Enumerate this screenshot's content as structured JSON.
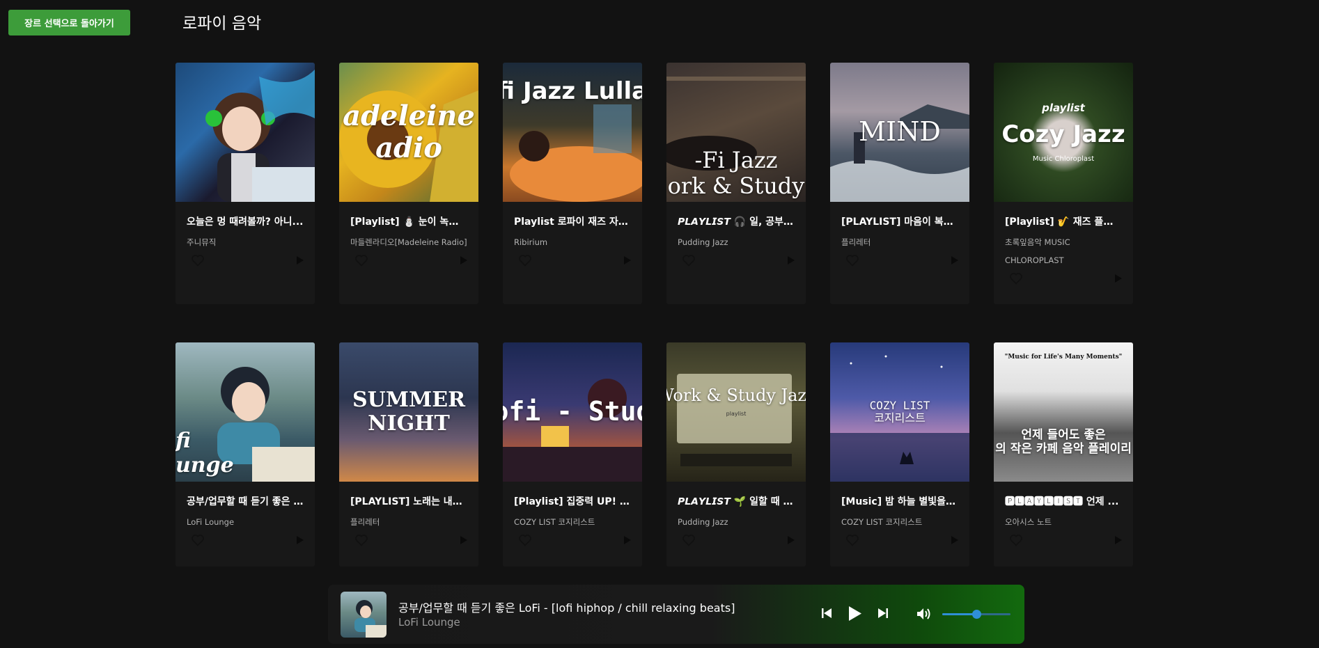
{
  "header": {
    "back_label": "장르 선택으로 돌아가기",
    "page_title": "로파이 음악"
  },
  "row1": [
    {
      "title": "오늘은 멍 때려볼까? 아니...",
      "artist": "주니뮤직",
      "cover_text": ""
    },
    {
      "title": "[Playlist] ⛄ 눈이 녹고 봄...",
      "artist": "마들렌라디오[Madeleine Radio]",
      "cover_text": "adeleine adio"
    },
    {
      "title": "Playlist 로파이 재즈 자장...",
      "artist": "Ribirium",
      "cover_text": "fi Jazz Lulla"
    },
    {
      "title": "𝙋𝙇𝘼𝙔𝙇𝙄𝙎𝙏 🎧 일, 공부할 ...",
      "artist": "Pudding Jazz",
      "cover_text": "-Fi Jazz\nork & Study"
    },
    {
      "title": "[PLAYLIST] 마음이 복잡...",
      "artist": "플리레터",
      "cover_text": "MIND"
    },
    {
      "title": "[Playlist] 🎷 재즈 플레이...",
      "artist": "초록잎음악 MUSIC CHLOROPLAST",
      "cover_text": "Cozy Jazz"
    }
  ],
  "row2": [
    {
      "title": "공부/업무할 때 듣기 좋은 ...",
      "artist": "LoFi Lounge",
      "cover_text": "fi\nunge"
    },
    {
      "title": "[PLAYLIST] 노래는 내가 ...",
      "artist": "플리레터",
      "cover_text": "SUMMER\nNIGHT"
    },
    {
      "title": "[Playlist] 집중력 UP! 공부...",
      "artist": "COZY LIST 코지리스트",
      "cover_text": "ofi - Stud"
    },
    {
      "title": "𝙋𝙇𝘼𝙔𝙇𝙄𝙎𝙏 🌱 일할 때 틀...",
      "artist": "Pudding Jazz",
      "cover_text": "Work & Study Jazz"
    },
    {
      "title": "[Music] 밤 하늘 별빛을 보...",
      "artist": "COZY LIST 코지리스트",
      "cover_text": "COZY LIST\n코지리스트"
    },
    {
      "title": "🅿🅻🅰🆈🅻🅸🆂🆃 언제 ...",
      "artist": "오아시스 노트",
      "cover_text": "언제 들어도 좋은\n의 작은 카페 음악 플레이리"
    }
  ],
  "cover_extras": {
    "c6_top": "playlist",
    "c6_sub": "Music Chloroplast",
    "c10_sub": "playlist",
    "c12_top": "\"Music for Life's Many Moments\""
  },
  "player": {
    "title": "공부/업무할 때 듣기 좋은 LoFi - [lofi hiphop / chill relaxing beats]",
    "artist": "LoFi Lounge",
    "volume": 0.5
  },
  "icons": {
    "heart": "heart-outline-icon",
    "play": "play-icon",
    "prev": "skip-previous-icon",
    "next": "skip-next-icon",
    "volume": "volume-icon"
  },
  "colors": {
    "accent_green": "#3d9c3a",
    "background": "#121212",
    "card": "#181818",
    "slider": "#2f8fd6"
  }
}
